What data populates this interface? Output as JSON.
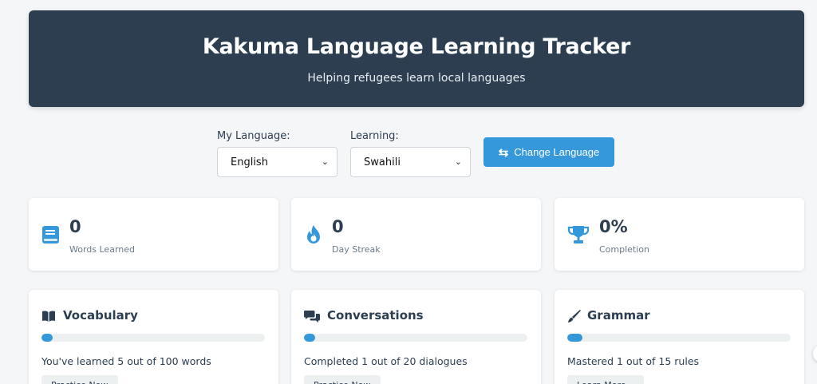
{
  "header": {
    "title": "Kakuma Language Learning Tracker",
    "subtitle": "Helping refugees learn local languages"
  },
  "controls": {
    "my_language_label": "My Language:",
    "my_language_value": "English",
    "learning_label": "Learning:",
    "learning_value": "Swahili",
    "change_button_label": "Change Language"
  },
  "stats": [
    {
      "value": "0",
      "label": "Words Learned",
      "icon": "book-icon"
    },
    {
      "value": "0",
      "label": "Day Streak",
      "icon": "fire-icon"
    },
    {
      "value": "0%",
      "label": "Completion",
      "icon": "trophy-icon"
    }
  ],
  "features": [
    {
      "title": "Vocabulary",
      "icon": "open-book-icon",
      "progress": 0.05,
      "description": "You've learned 5 out of 100 words",
      "button": "Practice Now"
    },
    {
      "title": "Conversations",
      "icon": "comments-icon",
      "progress": 0.05,
      "description": "Completed 1 out of 20 dialogues",
      "button": "Practice Now"
    },
    {
      "title": "Grammar",
      "icon": "pen-icon",
      "progress": 0.0667,
      "description": "Mastered 1 out of 15 rules",
      "button": "Learn More"
    }
  ],
  "colors": {
    "header_bg": "#2c3e50",
    "accent": "#3498db",
    "track": "#ecf0f1",
    "page_bg": "#f5f6f8"
  }
}
